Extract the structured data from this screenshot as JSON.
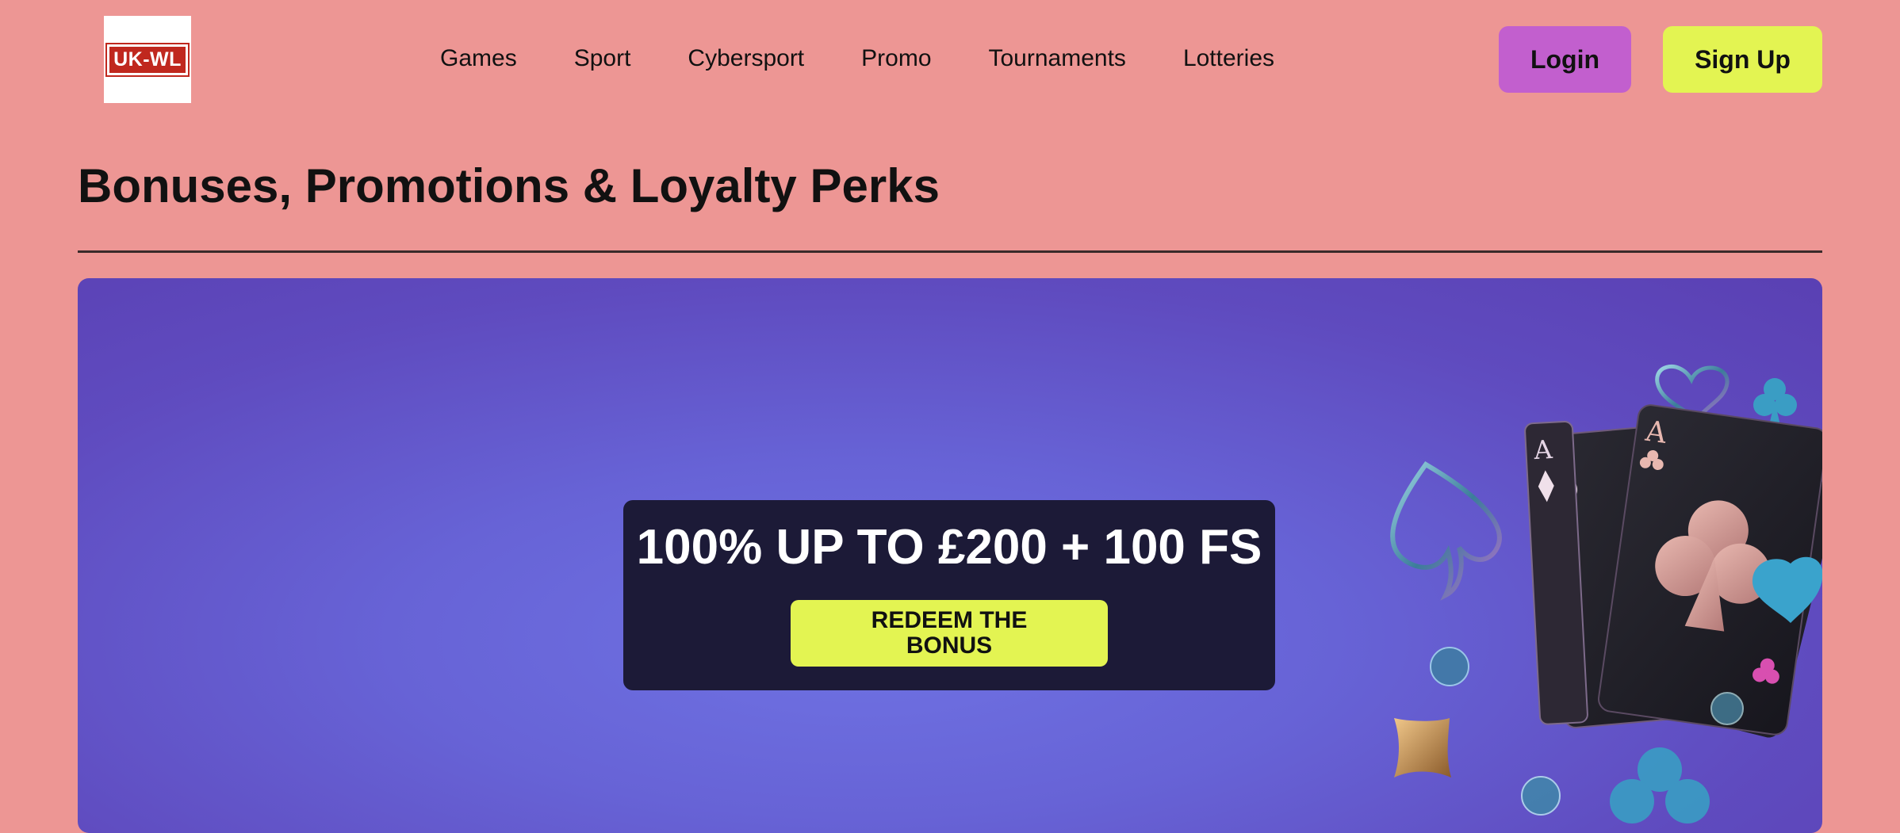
{
  "header": {
    "logo_text": "UK-WL",
    "nav": [
      {
        "label": "Games"
      },
      {
        "label": "Sport"
      },
      {
        "label": "Cybersport"
      },
      {
        "label": "Promo"
      },
      {
        "label": "Tournaments"
      },
      {
        "label": "Lotteries"
      }
    ],
    "login_label": "Login",
    "signup_label": "Sign Up"
  },
  "page": {
    "title": "Bonuses, Promotions & Loyalty Perks"
  },
  "banner": {
    "offer_title": "100% UP TO £200 + 100 FS",
    "redeem_label": "REDEEM THE BONUS",
    "art": {
      "icon": "playing-cards-aces-icon",
      "card_ranks": [
        "A",
        "A",
        "A"
      ]
    }
  },
  "colors": {
    "page_background": "#ed9694",
    "login_button": "#c25fce",
    "signup_button": "#e3f452",
    "banner_gradient_center": "#6f72e3",
    "banner_gradient_edge": "#5a40b3",
    "offer_box": "#1c1a37"
  }
}
